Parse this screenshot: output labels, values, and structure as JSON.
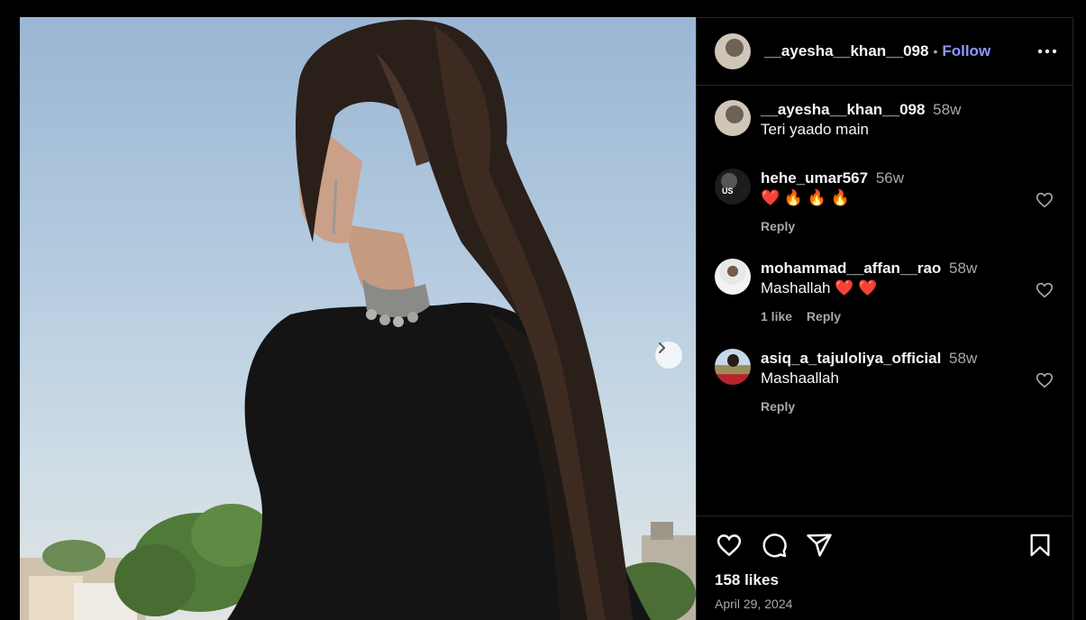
{
  "post": {
    "author": "__ayesha__khan__098",
    "follow_label": "Follow",
    "separator": "•",
    "caption_time": "58w",
    "caption": "Teri yaado main",
    "likes": "158 likes",
    "date": "April 29, 2024"
  },
  "comments": [
    {
      "user": "hehe_umar567",
      "time": "56w",
      "text": "❤️ 🔥 🔥 🔥",
      "meta": [
        "Reply"
      ]
    },
    {
      "user": "mohammad__affan__rao",
      "time": "58w",
      "text": "Mashallah ❤️ ❤️",
      "meta": [
        "1 like",
        "Reply"
      ]
    },
    {
      "user": "asiq_a_tajuloliya_official",
      "time": "58w",
      "text": "Mashaallah",
      "meta": [
        "Reply"
      ]
    }
  ],
  "avatar_badge": "US",
  "colors": {
    "accent": "#8c98ff",
    "muted": "#a8a8a8",
    "divider": "#262626"
  },
  "icons": [
    "more-icon",
    "chevron-right-icon",
    "heart-icon",
    "comment-icon",
    "share-icon",
    "bookmark-icon"
  ]
}
